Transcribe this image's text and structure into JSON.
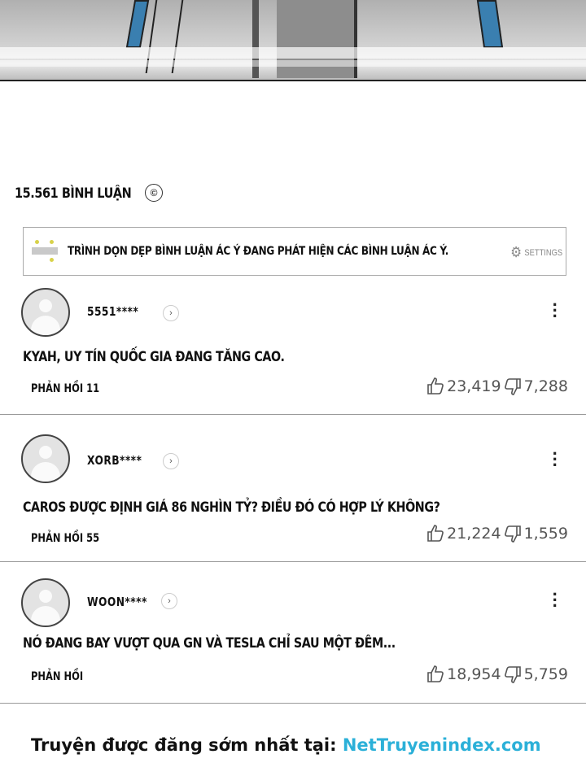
{
  "header": {
    "title": "15.561 BÌNH LUẬN",
    "copyright_glyph": "©"
  },
  "filter": {
    "text": "TRÌNH DỌN DẸP BÌNH LUẬN ÁC Ý ĐANG PHÁT HIỆN CÁC BÌNH LUẬN ÁC Ý.",
    "settings_label": "SETTINGS"
  },
  "comments": [
    {
      "user": "5551****",
      "text": "KYAH, UY TÍN QUỐC GIA ĐANG TĂNG CAO.",
      "reply": "PHẢN HỒI 11",
      "likes": "23,419",
      "dislikes": "7,288"
    },
    {
      "user": "XORB****",
      "text": "CAROS ĐƯỢC ĐỊNH GIÁ 86 NGHÌN TỶ? ĐIỀU ĐÓ CÓ HỢP LÝ KHÔNG?",
      "reply": "PHẢN HỒI 55",
      "likes": "21,224",
      "dislikes": "1,559"
    },
    {
      "user": "WOON****",
      "text": "NÓ ĐANG BAY VƯỢT QUA GN VÀ TESLA CHỈ SAU MỘT ĐÊM...",
      "reply": "PHẢN HỒI",
      "likes": "18,954",
      "dislikes": "5,759"
    }
  ],
  "footer": {
    "prefix": "Truyện được đăng sớm nhất tại: ",
    "site": "NetTruyenindex.com"
  },
  "colors": {
    "site_link": "#2bb0d8",
    "divider": "#9a9a9a"
  },
  "icons": [
    "copyright-icon",
    "broom-icon",
    "gear-icon",
    "avatar-icon",
    "chevron-right-icon",
    "more-vertical-icon",
    "thumb-up-icon",
    "thumb-down-icon"
  ]
}
